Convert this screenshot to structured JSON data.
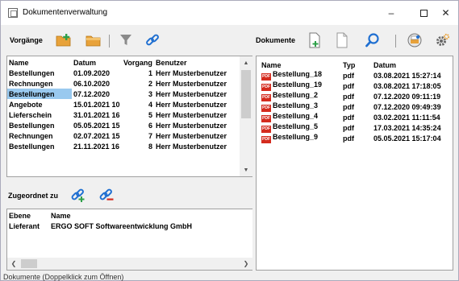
{
  "window": {
    "title": "Dokumentenverwaltung",
    "minimize_glyph": "–",
    "close_glyph": "✕"
  },
  "left_toolbar": {
    "label": "Vorgänge",
    "buttons": [
      "add-folder-icon",
      "folder-icon",
      "filter-icon",
      "link-icon"
    ]
  },
  "right_toolbar": {
    "label": "Dokumente",
    "buttons": [
      "add-document-icon",
      "document-icon",
      "search-icon",
      "scanner-icon",
      "settings-icon"
    ]
  },
  "vorgaenge_table": {
    "columns": [
      "Name",
      "Datum",
      "Vorgang",
      "Benutzer"
    ],
    "rows": [
      {
        "name": "Bestellungen",
        "datum": "01.09.2020",
        "vorgang": "1",
        "benutzer": "Herr Musterbenutzer"
      },
      {
        "name": "Rechnungen",
        "datum": "06.10.2020",
        "vorgang": "2",
        "benutzer": "Herr Musterbenutzer"
      },
      {
        "name": "Bestellungen",
        "datum": "07.12.2020",
        "vorgang": "3",
        "benutzer": "Herr Musterbenutzer"
      },
      {
        "name": "Angebote",
        "datum": "15.01.2021 10",
        "vorgang": "4",
        "benutzer": "Herr Musterbenutzer"
      },
      {
        "name": "Lieferschein",
        "datum": "31.01.2021 16",
        "vorgang": "5",
        "benutzer": "Herr Musterbenutzer"
      },
      {
        "name": "Bestellungen",
        "datum": "05.05.2021 15",
        "vorgang": "6",
        "benutzer": "Herr Musterbenutzer"
      },
      {
        "name": "Rechnungen",
        "datum": "02.07.2021 15",
        "vorgang": "7",
        "benutzer": "Herr Musterbenutzer"
      },
      {
        "name": "Bestellungen",
        "datum": "21.11.2021 16",
        "vorgang": "8",
        "benutzer": "Herr Musterbenutzer"
      }
    ],
    "selected_index": 2
  },
  "zugeordnet": {
    "label": "Zugeordnet zu",
    "buttons": [
      "add-link-icon",
      "remove-link-icon"
    ],
    "columns": [
      "Ebene",
      "Name"
    ],
    "rows": [
      {
        "ebene": "Lieferant",
        "name": "ERGO SOFT Softwareentwicklung GmbH"
      }
    ]
  },
  "dokumente_table": {
    "columns": [
      "Name",
      "Typ",
      "Datum"
    ],
    "rows": [
      {
        "name": "Bestellung_18",
        "typ": "pdf",
        "datum": "03.08.2021 15:27:14"
      },
      {
        "name": "Bestellung_19",
        "typ": "pdf",
        "datum": "03.08.2021 17:18:05"
      },
      {
        "name": "Bestellung_2",
        "typ": "pdf",
        "datum": "07.12.2020 09:11:19"
      },
      {
        "name": "Bestellung_3",
        "typ": "pdf",
        "datum": "07.12.2020 09:49:39"
      },
      {
        "name": "Bestellung_4",
        "typ": "pdf",
        "datum": "03.02.2021 11:11:54"
      },
      {
        "name": "Bestellung_5",
        "typ": "pdf",
        "datum": "17.03.2021 14:35:24"
      },
      {
        "name": "Bestellung_9",
        "typ": "pdf",
        "datum": "05.05.2021 15:17:04"
      }
    ],
    "file_icon_text": "PDF"
  },
  "status": {
    "text": "Dokumente (Doppelklick zum Öffnen)"
  },
  "colors": {
    "selection": "#99c9ef",
    "pdf_red": "#d42b1e",
    "folder_orange": "#e8a23a",
    "link_blue": "#1f6fd1"
  }
}
